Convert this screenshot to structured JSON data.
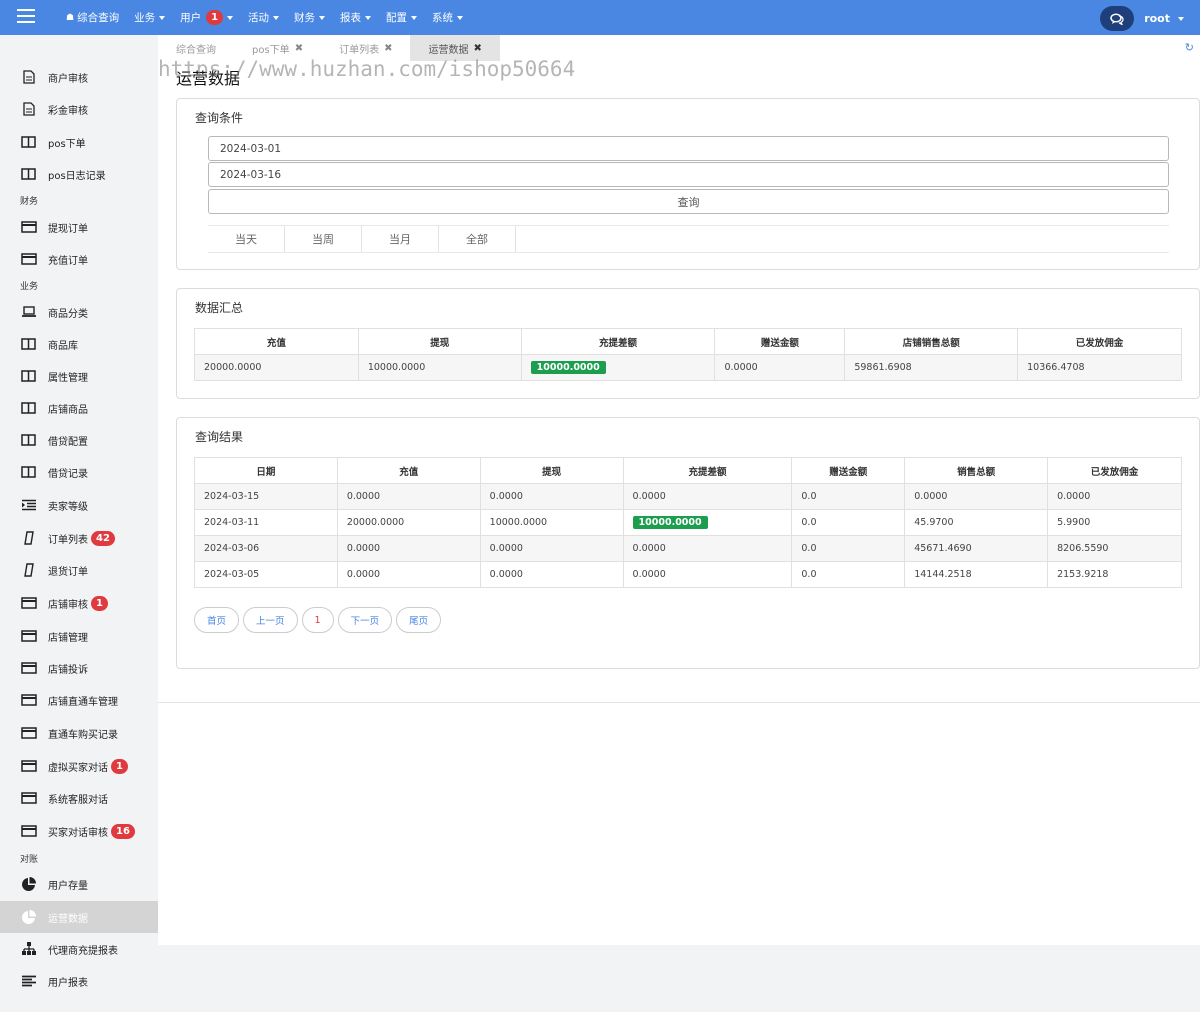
{
  "navbar": {
    "items": [
      {
        "label": "综合查询"
      },
      {
        "label": "业务"
      },
      {
        "label": "用户",
        "badge": "1"
      },
      {
        "label": "活动"
      },
      {
        "label": "财务"
      },
      {
        "label": "报表"
      },
      {
        "label": "配置"
      },
      {
        "label": "系统"
      }
    ],
    "user": "root"
  },
  "sidebar": {
    "items": [
      {
        "label": "商户审核",
        "icon": "document-icon"
      },
      {
        "label": "彩金审核",
        "icon": "document-icon"
      },
      {
        "label": "pos下单",
        "icon": "columns-icon"
      },
      {
        "label": "pos日志记录",
        "icon": "columns-icon"
      },
      {
        "label": "提现订单",
        "icon": "card-icon"
      },
      {
        "label": "充值订单",
        "icon": "card-icon"
      },
      {
        "label": "商品分类",
        "icon": "laptop-icon"
      },
      {
        "label": "商品库",
        "icon": "columns-icon"
      },
      {
        "label": "属性管理",
        "icon": "columns-icon"
      },
      {
        "label": "店铺商品",
        "icon": "columns-icon"
      },
      {
        "label": "借贷配置",
        "icon": "columns-icon"
      },
      {
        "label": "借贷记录",
        "icon": "columns-icon"
      },
      {
        "label": "卖家等级",
        "icon": "list-indent-icon"
      },
      {
        "label": "订单列表",
        "icon": "mobile-icon",
        "badge": "42"
      },
      {
        "label": "退货订单",
        "icon": "mobile-icon"
      },
      {
        "label": "店铺审核",
        "icon": "card-icon",
        "badge": "1"
      },
      {
        "label": "店铺管理",
        "icon": "card-icon"
      },
      {
        "label": "店铺投诉",
        "icon": "card-icon"
      },
      {
        "label": "店铺直通车管理",
        "icon": "card-icon"
      },
      {
        "label": "直通车购买记录",
        "icon": "card-icon"
      },
      {
        "label": "虚拟买家对话",
        "icon": "card-icon",
        "badge": "1"
      },
      {
        "label": "系统客服对话",
        "icon": "card-icon"
      },
      {
        "label": "买家对话审核",
        "icon": "card-icon",
        "badge": "16"
      },
      {
        "label": "用户存量",
        "icon": "pie-chart-icon"
      },
      {
        "label": "运营数据",
        "icon": "pie-chart-icon",
        "active": true
      },
      {
        "label": "代理商充提报表",
        "icon": "sitemap-icon"
      },
      {
        "label": "用户报表",
        "icon": "align-left-icon"
      }
    ],
    "sections": [
      "财务",
      "业务",
      "对账"
    ]
  },
  "tabs": [
    {
      "label": "综合查询",
      "closable": false
    },
    {
      "label": "pos下单",
      "closable": true
    },
    {
      "label": "订单列表",
      "closable": true
    },
    {
      "label": "运营数据",
      "closable": true,
      "active": true
    }
  ],
  "page_title": "运营数据",
  "watermark": "https://www.huzhan.com/ishop50664",
  "query": {
    "title": "查询条件",
    "start_date": "2024-03-01",
    "end_date": "2024-03-16",
    "button": "查询",
    "quick": [
      "当天",
      "当周",
      "当月",
      "全部"
    ]
  },
  "summary": {
    "title": "数据汇总",
    "headers": [
      "充值",
      "提现",
      "充提差额",
      "赠送金额",
      "店铺销售总额",
      "已发放佣金"
    ],
    "row": [
      "20000.0000",
      "10000.0000",
      "10000.0000",
      "0.0000",
      "59861.6908",
      "10366.4708"
    ]
  },
  "results": {
    "title": "查询结果",
    "headers": [
      "日期",
      "充值",
      "提现",
      "充提差额",
      "赠送金额",
      "销售总额",
      "已发放佣金"
    ],
    "rows": [
      [
        "2024-03-15",
        "0.0000",
        "0.0000",
        "0.0000",
        "0.0",
        "0.0000",
        "0.0000"
      ],
      [
        "2024-03-11",
        "20000.0000",
        "10000.0000",
        "10000.0000",
        "0.0",
        "45.9700",
        "5.9900"
      ],
      [
        "2024-03-06",
        "0.0000",
        "0.0000",
        "0.0000",
        "0.0",
        "45671.4690",
        "8206.5590"
      ],
      [
        "2024-03-05",
        "0.0000",
        "0.0000",
        "0.0000",
        "0.0",
        "14144.2518",
        "2153.9218"
      ]
    ]
  },
  "pager": {
    "first": "首页",
    "prev": "上一页",
    "current": "1",
    "next": "下一页",
    "last": "尾页"
  },
  "colors": {
    "navbar": "#4a87e3",
    "badge": "#e0393e",
    "positive": "#1d9e4f"
  }
}
